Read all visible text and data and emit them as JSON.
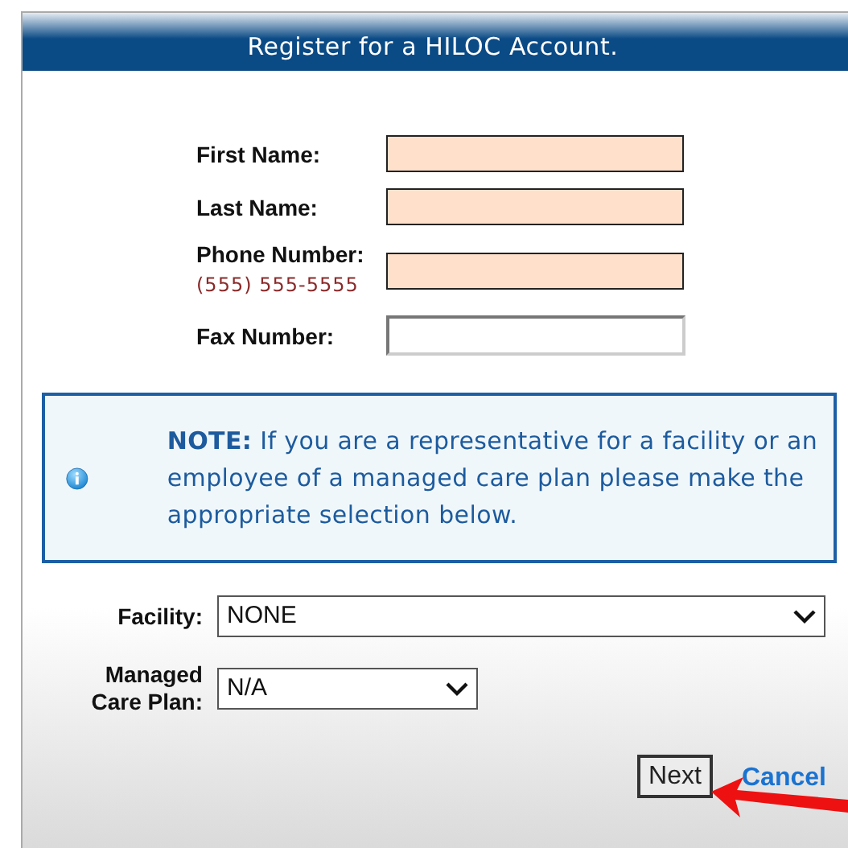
{
  "dialog": {
    "title": "Register for a HILOC Account."
  },
  "fields": [
    {
      "label": "First Name:",
      "required": true
    },
    {
      "label": "Last Name:",
      "required": true
    },
    {
      "label": "Phone Number:",
      "hint": "(555) 555-5555",
      "required": true
    },
    {
      "label": "Fax Number:",
      "required": false
    }
  ],
  "note": {
    "text": "**NOTE:** If you are a representative for a facility or an employee of a managed care plan please make the appropriate selection below."
  },
  "selects": [
    {
      "label": "Facility:",
      "value": "NONE",
      "wide": true
    },
    {
      "label": "Managed Care Plan:",
      "value": "N/A",
      "wide": false
    }
  ],
  "buttons": {
    "next": "Next",
    "cancel": "Cancel"
  }
}
